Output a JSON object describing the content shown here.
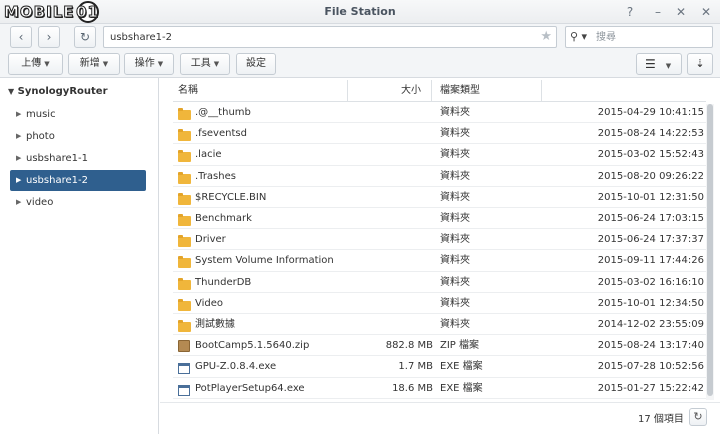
{
  "window": {
    "title": "File Station",
    "watermark": "MOBILE",
    "watermark_badge": "01",
    "help_icon": "question-icon",
    "minimize_icon": "minimize-icon",
    "maximize_icon": "maximize-icon",
    "close_icon": "close-icon"
  },
  "addressbar": {
    "back_icon": "chevron-left-icon",
    "forward_icon": "chevron-right-icon",
    "refresh_icon": "refresh-icon",
    "path_value": "usbshare1-2",
    "search_placeholder": "搜尋"
  },
  "toolbar": {
    "upload": "上傳",
    "new": "新增",
    "action": "操作",
    "tools": "工具",
    "settings": "設定"
  },
  "sidebar": {
    "root": "SynologyRouter",
    "items": [
      {
        "label": "music"
      },
      {
        "label": "photo"
      },
      {
        "label": "usbshare1-1"
      },
      {
        "label": "usbshare1-2"
      },
      {
        "label": "video"
      }
    ],
    "selected": "usbshare1-2"
  },
  "columns": {
    "name": "名稱",
    "size": "大小",
    "type": "檔案類型",
    "modified": ""
  },
  "files": [
    {
      "name": ".@__thumb",
      "size": "",
      "type": "資料夾",
      "date": "2015-04-29 10:41:15",
      "icon": "folder-icon"
    },
    {
      "name": ".fseventsd",
      "size": "",
      "type": "資料夾",
      "date": "2015-08-24 14:22:53",
      "icon": "folder-icon"
    },
    {
      "name": ".lacie",
      "size": "",
      "type": "資料夾",
      "date": "2015-03-02 15:52:43",
      "icon": "folder-icon"
    },
    {
      "name": ".Trashes",
      "size": "",
      "type": "資料夾",
      "date": "2015-08-20 09:26:22",
      "icon": "folder-icon"
    },
    {
      "name": "$RECYCLE.BIN",
      "size": "",
      "type": "資料夾",
      "date": "2015-10-01 12:31:50",
      "icon": "folder-icon"
    },
    {
      "name": "Benchmark",
      "size": "",
      "type": "資料夾",
      "date": "2015-06-24 17:03:15",
      "icon": "folder-icon"
    },
    {
      "name": "Driver",
      "size": "",
      "type": "資料夾",
      "date": "2015-06-24 17:37:37",
      "icon": "folder-icon"
    },
    {
      "name": "System Volume Information",
      "size": "",
      "type": "資料夾",
      "date": "2015-09-11 17:44:26",
      "icon": "folder-icon"
    },
    {
      "name": "ThunderDB",
      "size": "",
      "type": "資料夾",
      "date": "2015-03-02 16:16:10",
      "icon": "folder-icon"
    },
    {
      "name": "Video",
      "size": "",
      "type": "資料夾",
      "date": "2015-10-01 12:34:50",
      "icon": "folder-icon"
    },
    {
      "name": "測試數據",
      "size": "",
      "type": "資料夾",
      "date": "2014-12-02 23:55:09",
      "icon": "folder-icon"
    },
    {
      "name": "BootCamp5.1.5640.zip",
      "size": "882.8 MB",
      "type": "ZIP 檔案",
      "date": "2015-08-24 13:17:40",
      "icon": "zip-file-icon"
    },
    {
      "name": "GPU-Z.0.8.4.exe",
      "size": "1.7 MB",
      "type": "EXE 檔案",
      "date": "2015-07-28 10:52:56",
      "icon": "exe-file-icon"
    },
    {
      "name": "PotPlayerSetup64.exe",
      "size": "18.6 MB",
      "type": "EXE 檔案",
      "date": "2015-01-27 15:22:42",
      "icon": "exe-file-icon"
    }
  ],
  "footer": {
    "item_count": "17 個項目"
  }
}
